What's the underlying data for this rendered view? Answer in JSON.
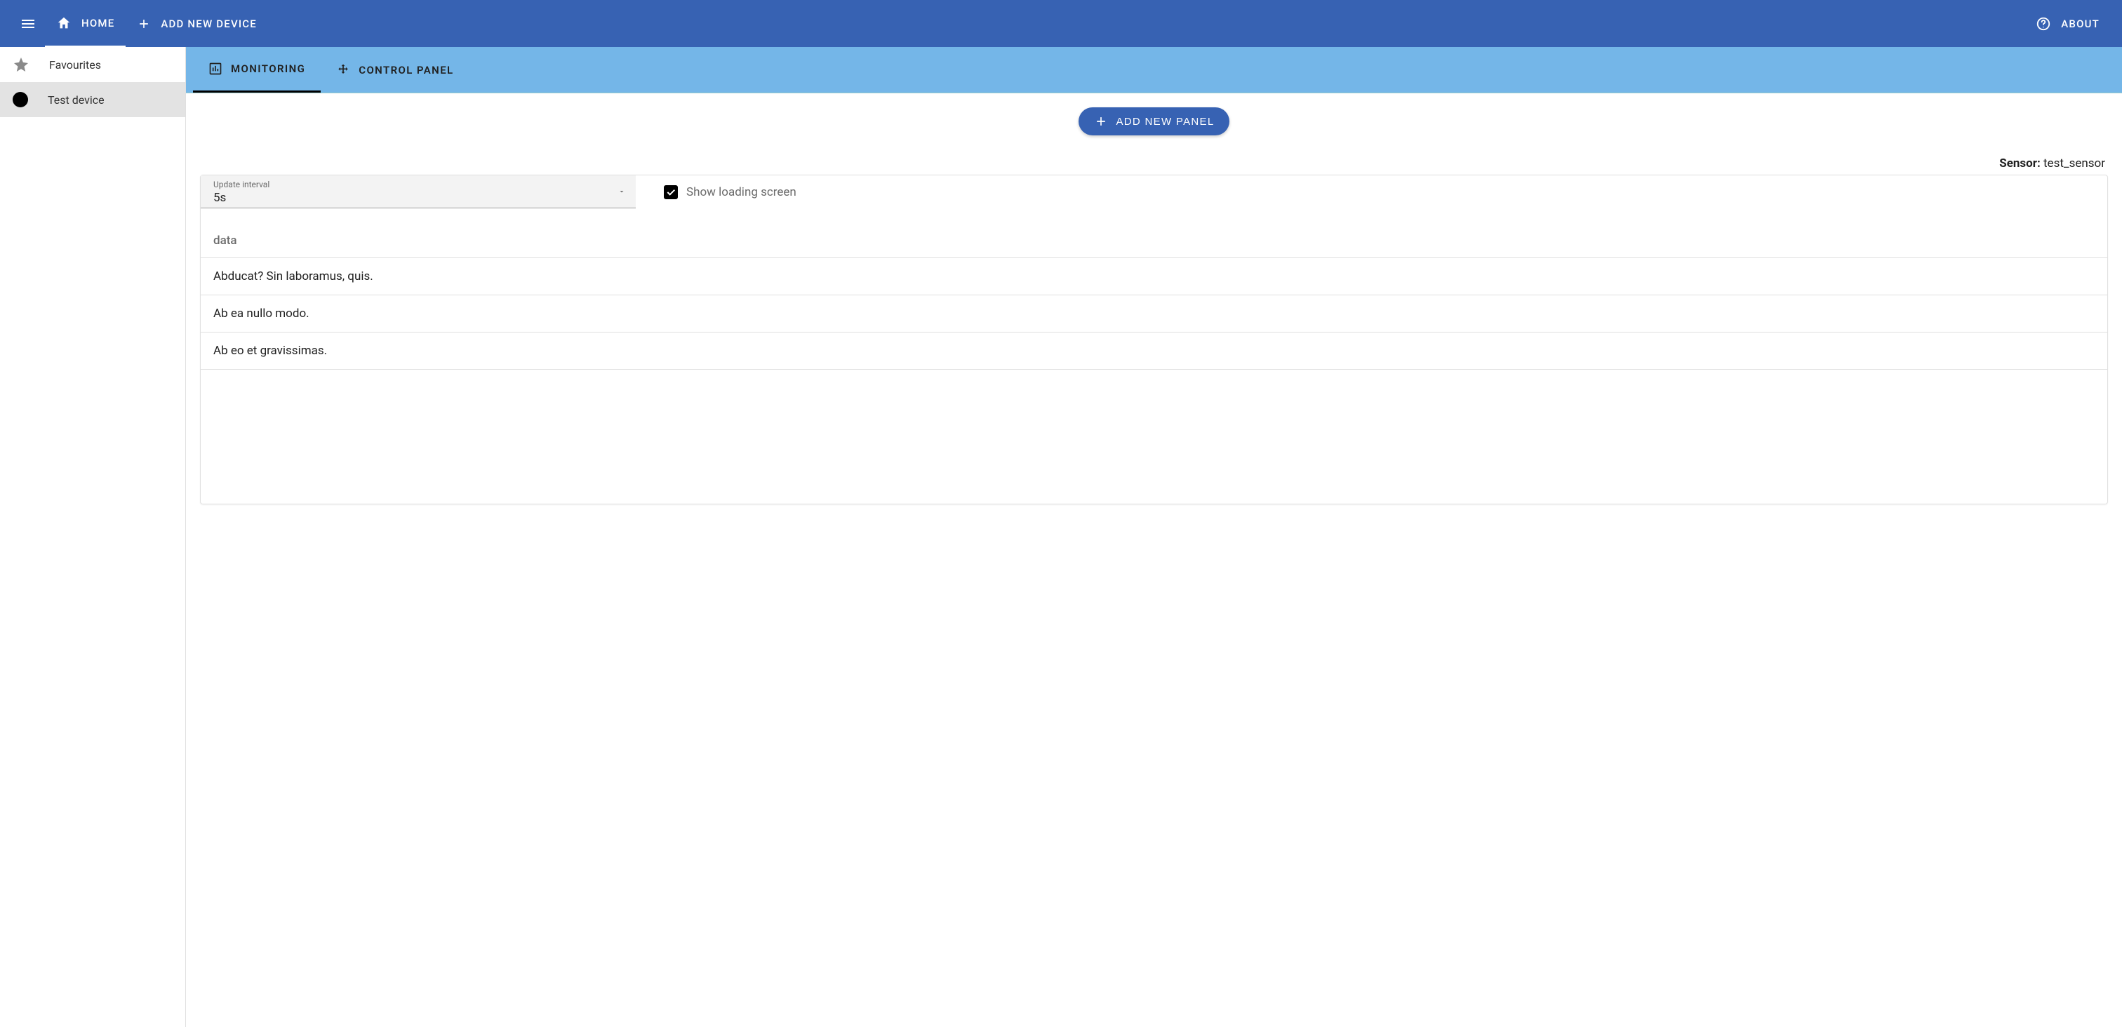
{
  "appbar": {
    "home_label": "HOME",
    "add_device_label": "ADD NEW DEVICE",
    "about_label": "ABOUT"
  },
  "sidebar": {
    "items": [
      {
        "label": "Favourites",
        "icon": "star",
        "selected": false
      },
      {
        "label": "Test device",
        "icon": "dot",
        "selected": true
      }
    ]
  },
  "tabs": [
    {
      "label": "MONITORING",
      "icon": "chart",
      "active": true
    },
    {
      "label": "CONTROL PANEL",
      "icon": "move",
      "active": false
    }
  ],
  "main": {
    "add_panel_label": "ADD NEW PANEL",
    "sensor_label": "Sensor:",
    "sensor_value": "test_sensor",
    "update_interval_label": "Update interval",
    "update_interval_value": "5s",
    "show_loading_label": "Show loading screen",
    "show_loading_checked": true,
    "table_header": "data",
    "rows": [
      "Abducat? Sin laboramus, quis.",
      "Ab ea nullo modo.",
      "Ab eo et gravissimas."
    ]
  },
  "colors": {
    "primary": "#3762b3",
    "secondary": "#74b6e8"
  }
}
